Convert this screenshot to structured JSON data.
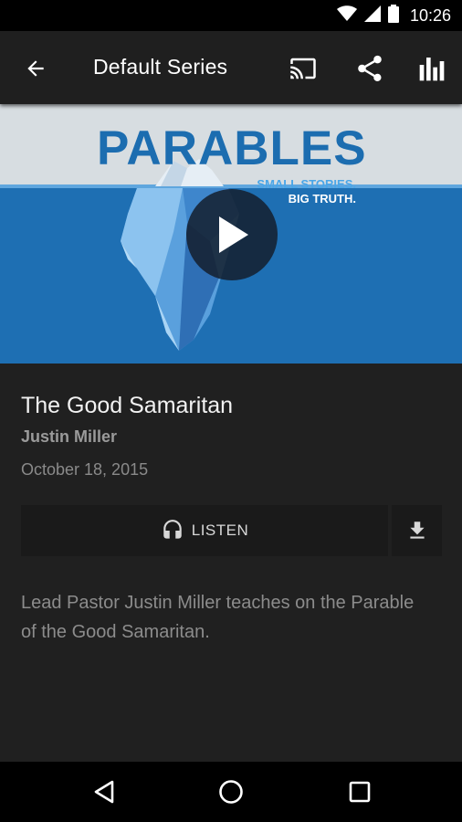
{
  "status_bar": {
    "time": "10:26",
    "icons": [
      "wifi-icon",
      "cell-signal-icon",
      "battery-icon"
    ]
  },
  "app_bar": {
    "title": "Default Series",
    "actions": [
      "cast-icon",
      "share-icon",
      "stats-icon"
    ]
  },
  "artwork": {
    "title": "PARABLES",
    "tagline_line1": "SMALL STORIES.",
    "tagline_line2": "BIG TRUTH."
  },
  "episode": {
    "title": "The Good Samaritan",
    "author": "Justin Miller",
    "date": "October 18, 2015",
    "listen_label": "LISTEN",
    "description": "Lead Pastor Justin Miller teaches on the Parable of the Good Samaritan."
  },
  "colors": {
    "background": "#202020",
    "app_bar": "#1f1f1f",
    "artwork_sky": "#d7dde1",
    "artwork_water": "#1e6fb3",
    "artwork_title": "#1c6db0"
  },
  "nav_bar": {
    "icons": [
      "back-triangle-icon",
      "home-circle-icon",
      "recents-square-icon"
    ]
  }
}
